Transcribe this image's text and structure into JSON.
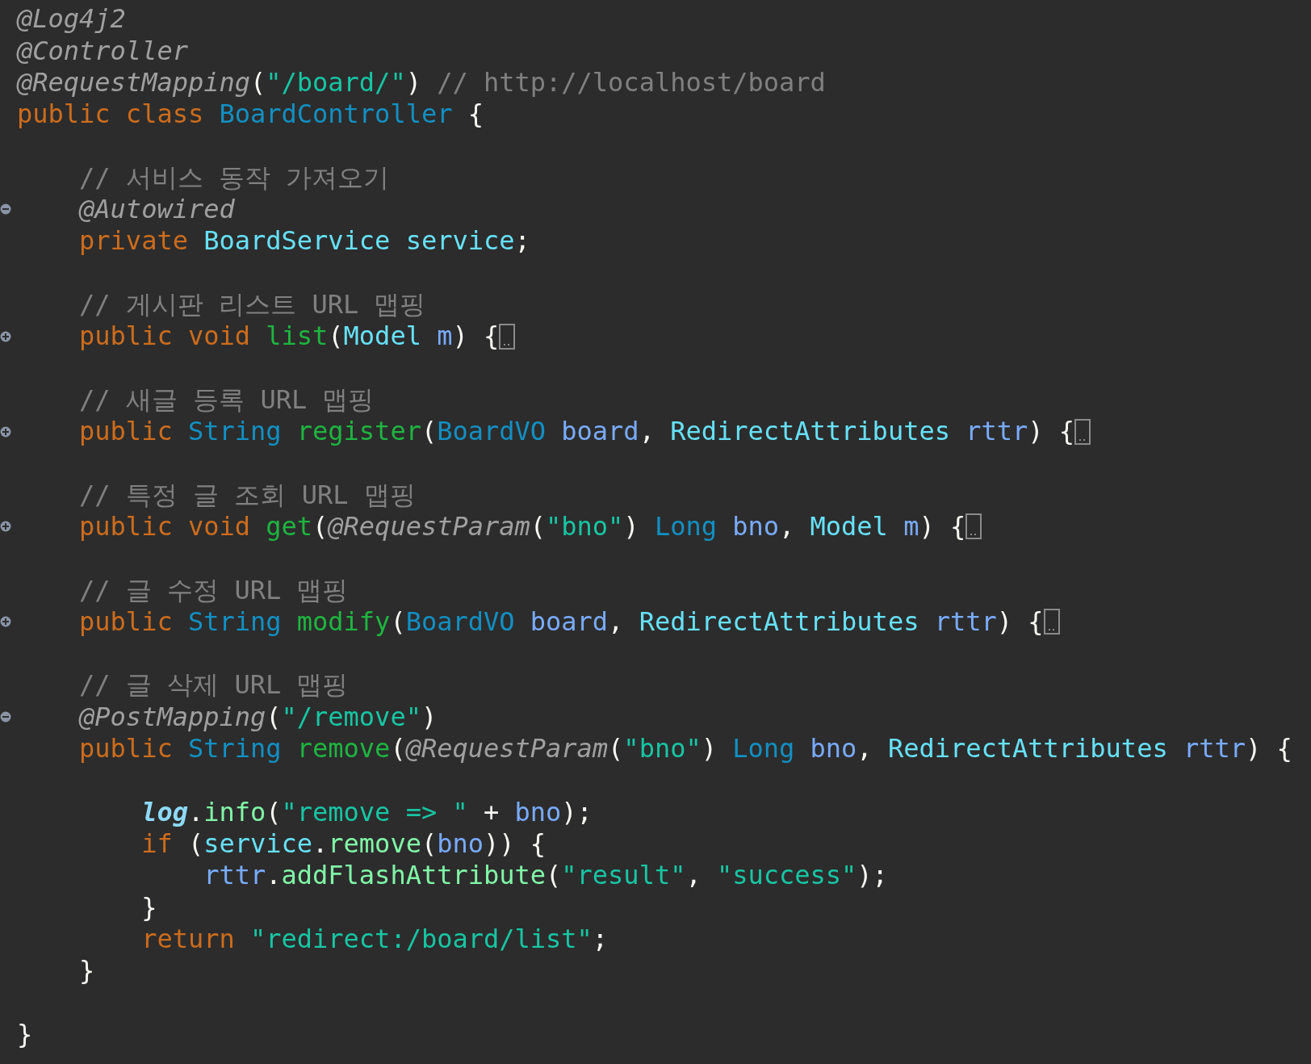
{
  "editor": {
    "lines": [
      {
        "kind": "code",
        "tokens": [
          {
            "kind": "annotation",
            "text": "@Log4j2"
          }
        ]
      },
      {
        "kind": "code",
        "tokens": [
          {
            "kind": "annotation",
            "text": "@Controller"
          }
        ]
      },
      {
        "kind": "code",
        "tokens": [
          {
            "kind": "annotation",
            "text": "@RequestMapping"
          },
          {
            "kind": "plain",
            "text": "("
          },
          {
            "kind": "string",
            "text": "\"/board/\""
          },
          {
            "kind": "plain",
            "text": ") "
          },
          {
            "kind": "comment",
            "text": "// http://localhost/board"
          }
        ]
      },
      {
        "kind": "code",
        "tokens": [
          {
            "kind": "keyword",
            "text": "public class "
          },
          {
            "kind": "type",
            "text": "BoardController"
          },
          {
            "kind": "plain",
            "text": " {"
          }
        ]
      },
      {
        "kind": "blank"
      },
      {
        "kind": "code",
        "tokens": [
          {
            "kind": "comment",
            "text": "    // 서비스 동작 가져오기"
          }
        ]
      },
      {
        "kind": "code",
        "collapsed": false,
        "tokens": [
          {
            "kind": "annotation",
            "text": "    @Autowired"
          }
        ]
      },
      {
        "kind": "code",
        "tokens": [
          {
            "kind": "keyword",
            "text": "    private "
          },
          {
            "kind": "class",
            "text": "BoardService "
          },
          {
            "kind": "field",
            "text": "service"
          },
          {
            "kind": "plain",
            "text": ";"
          }
        ]
      },
      {
        "kind": "blank"
      },
      {
        "kind": "code",
        "tokens": [
          {
            "kind": "comment",
            "text": "    // 게시판 리스트 URL 맵핑"
          }
        ]
      },
      {
        "kind": "code",
        "collapsed": true,
        "tokens": [
          {
            "kind": "keyword",
            "text": "    public void "
          },
          {
            "kind": "method",
            "text": "list"
          },
          {
            "kind": "plain",
            "text": "("
          },
          {
            "kind": "class",
            "text": "Model "
          },
          {
            "kind": "param",
            "text": "m"
          },
          {
            "kind": "plain",
            "text": ") {"
          }
        ]
      },
      {
        "kind": "blank"
      },
      {
        "kind": "code",
        "tokens": [
          {
            "kind": "comment",
            "text": "    // 새글 등록 URL 맵핑"
          }
        ]
      },
      {
        "kind": "code",
        "collapsed": true,
        "tokens": [
          {
            "kind": "keyword",
            "text": "    public "
          },
          {
            "kind": "type",
            "text": "String "
          },
          {
            "kind": "method",
            "text": "register"
          },
          {
            "kind": "plain",
            "text": "("
          },
          {
            "kind": "type",
            "text": "BoardVO "
          },
          {
            "kind": "param",
            "text": "board"
          },
          {
            "kind": "plain",
            "text": ", "
          },
          {
            "kind": "class",
            "text": "RedirectAttributes "
          },
          {
            "kind": "param",
            "text": "rttr"
          },
          {
            "kind": "plain",
            "text": ") {"
          }
        ]
      },
      {
        "kind": "blank"
      },
      {
        "kind": "code",
        "tokens": [
          {
            "kind": "comment",
            "text": "    // 특정 글 조회 URL 맵핑"
          }
        ]
      },
      {
        "kind": "code",
        "collapsed": true,
        "tokens": [
          {
            "kind": "keyword",
            "text": "    public void "
          },
          {
            "kind": "method",
            "text": "get"
          },
          {
            "kind": "plain",
            "text": "("
          },
          {
            "kind": "annotation",
            "text": "@RequestParam"
          },
          {
            "kind": "plain",
            "text": "("
          },
          {
            "kind": "string",
            "text": "\"bno\""
          },
          {
            "kind": "plain",
            "text": ") "
          },
          {
            "kind": "type",
            "text": "Long "
          },
          {
            "kind": "param",
            "text": "bno"
          },
          {
            "kind": "plain",
            "text": ", "
          },
          {
            "kind": "class",
            "text": "Model "
          },
          {
            "kind": "param",
            "text": "m"
          },
          {
            "kind": "plain",
            "text": ") {"
          }
        ]
      },
      {
        "kind": "blank"
      },
      {
        "kind": "code",
        "tokens": [
          {
            "kind": "comment",
            "text": "    // 글 수정 URL 맵핑"
          }
        ]
      },
      {
        "kind": "code",
        "collapsed": true,
        "tokens": [
          {
            "kind": "keyword",
            "text": "    public "
          },
          {
            "kind": "type",
            "text": "String "
          },
          {
            "kind": "method",
            "text": "modify"
          },
          {
            "kind": "plain",
            "text": "("
          },
          {
            "kind": "type",
            "text": "BoardVO "
          },
          {
            "kind": "param",
            "text": "board"
          },
          {
            "kind": "plain",
            "text": ", "
          },
          {
            "kind": "class",
            "text": "RedirectAttributes "
          },
          {
            "kind": "param",
            "text": "rttr"
          },
          {
            "kind": "plain",
            "text": ") {"
          }
        ]
      },
      {
        "kind": "blank"
      },
      {
        "kind": "code",
        "tokens": [
          {
            "kind": "comment",
            "text": "    // 글 삭제 URL 맵핑"
          }
        ]
      },
      {
        "kind": "code",
        "collapsed": false,
        "tokens": [
          {
            "kind": "annotation",
            "text": "    @PostMapping"
          },
          {
            "kind": "plain",
            "text": "("
          },
          {
            "kind": "string",
            "text": "\"/remove\""
          },
          {
            "kind": "plain",
            "text": ")"
          }
        ]
      },
      {
        "kind": "code",
        "tokens": [
          {
            "kind": "keyword",
            "text": "    public "
          },
          {
            "kind": "type",
            "text": "String "
          },
          {
            "kind": "method",
            "text": "remove"
          },
          {
            "kind": "plain",
            "text": "("
          },
          {
            "kind": "annotation",
            "text": "@RequestParam"
          },
          {
            "kind": "plain",
            "text": "("
          },
          {
            "kind": "string",
            "text": "\"bno\""
          },
          {
            "kind": "plain",
            "text": ") "
          },
          {
            "kind": "type",
            "text": "Long "
          },
          {
            "kind": "param",
            "text": "bno"
          },
          {
            "kind": "plain",
            "text": ", "
          },
          {
            "kind": "class",
            "text": "RedirectAttributes "
          },
          {
            "kind": "param",
            "text": "rttr"
          },
          {
            "kind": "plain",
            "text": ") {"
          }
        ]
      },
      {
        "kind": "blank"
      },
      {
        "kind": "code",
        "tokens": [
          {
            "kind": "static",
            "text": "        log"
          },
          {
            "kind": "plain",
            "text": "."
          },
          {
            "kind": "call",
            "text": "info"
          },
          {
            "kind": "plain",
            "text": "("
          },
          {
            "kind": "string",
            "text": "\"remove => \""
          },
          {
            "kind": "plain",
            "text": " + "
          },
          {
            "kind": "param",
            "text": "bno"
          },
          {
            "kind": "plain",
            "text": ");"
          }
        ]
      },
      {
        "kind": "code",
        "tokens": [
          {
            "kind": "keyword",
            "text": "        if "
          },
          {
            "kind": "plain",
            "text": "("
          },
          {
            "kind": "field",
            "text": "service"
          },
          {
            "kind": "plain",
            "text": "."
          },
          {
            "kind": "call",
            "text": "remove"
          },
          {
            "kind": "plain",
            "text": "("
          },
          {
            "kind": "param",
            "text": "bno"
          },
          {
            "kind": "plain",
            "text": ")) {"
          }
        ]
      },
      {
        "kind": "code",
        "tokens": [
          {
            "kind": "param",
            "text": "            rttr"
          },
          {
            "kind": "plain",
            "text": "."
          },
          {
            "kind": "call",
            "text": "addFlashAttribute"
          },
          {
            "kind": "plain",
            "text": "("
          },
          {
            "kind": "string",
            "text": "\"result\""
          },
          {
            "kind": "plain",
            "text": ", "
          },
          {
            "kind": "string",
            "text": "\"success\""
          },
          {
            "kind": "plain",
            "text": ");"
          }
        ]
      },
      {
        "kind": "code",
        "tokens": [
          {
            "kind": "plain",
            "text": "        }"
          }
        ]
      },
      {
        "kind": "code",
        "tokens": [
          {
            "kind": "keyword",
            "text": "        return "
          },
          {
            "kind": "string",
            "text": "\"redirect:/board/list\""
          },
          {
            "kind": "plain",
            "text": ";"
          }
        ]
      },
      {
        "kind": "code",
        "tokens": [
          {
            "kind": "plain",
            "text": "    }"
          }
        ]
      },
      {
        "kind": "blank"
      },
      {
        "kind": "code",
        "tokens": [
          {
            "kind": "plain",
            "text": "}"
          }
        ]
      }
    ]
  }
}
